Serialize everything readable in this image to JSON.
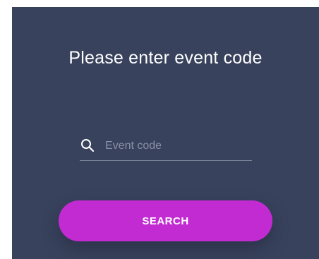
{
  "prompt": {
    "title": "Please enter event code"
  },
  "search": {
    "placeholder": "Event code",
    "value": "",
    "icon": "search-icon"
  },
  "actions": {
    "search_label": "SEARCH"
  },
  "colors": {
    "background": "#39425d",
    "accent": "#c22bd1",
    "text": "#ffffff",
    "placeholder": "#8a91a6",
    "underline": "#7d8498"
  }
}
